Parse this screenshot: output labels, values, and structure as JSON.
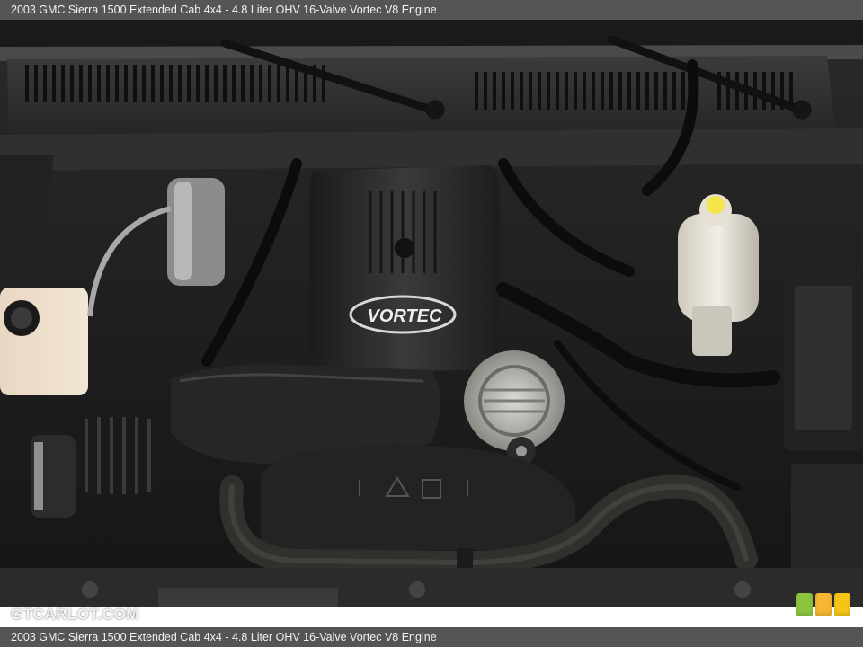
{
  "header": {
    "title": "2003 GMC Sierra 1500 Extended Cab 4x4 - 4.8 Liter OHV 16-Valve Vortec V8 Engine"
  },
  "footer": {
    "caption": "2003 GMC Sierra 1500 Extended Cab 4x4 - 4.8 Liter OHV 16-Valve Vortec V8 Engine"
  },
  "photo": {
    "engine_cover_text": "VORTEC"
  },
  "watermark": {
    "site": "GTCARLOT.COM"
  },
  "logo": {
    "colors": [
      "#8cc63f",
      "#f7b733",
      "#f5c518"
    ]
  }
}
